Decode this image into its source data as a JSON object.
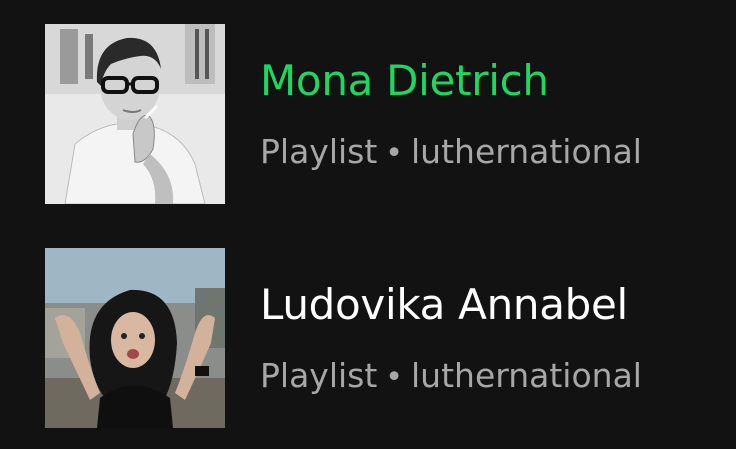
{
  "colors": {
    "background": "#121212",
    "active_title": "#1ed760",
    "title": "#ffffff",
    "subtitle": "#a7a7a7"
  },
  "items": [
    {
      "title": "Mona Dietrich",
      "type": "Playlist",
      "separator": "•",
      "owner": "luthernational",
      "active": true,
      "thumbnail": "playlist-cover-image"
    },
    {
      "title": "Ludovika Annabel",
      "type": "Playlist",
      "separator": "•",
      "owner": "luthernational",
      "active": false,
      "thumbnail": "playlist-cover-image"
    }
  ]
}
